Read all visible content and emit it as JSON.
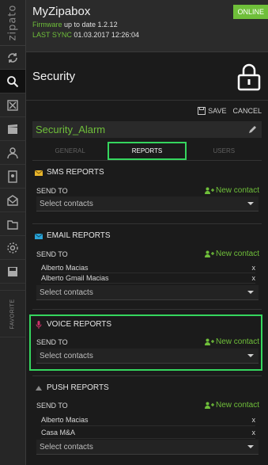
{
  "rail": {
    "logo": "zipato",
    "favorite_label": "FAVORITE"
  },
  "header": {
    "title": "MyZipabox",
    "status": "ONLINE",
    "firmware_label": "Firmware",
    "firmware_text": "up to date 1.2.12",
    "sync_label": "LAST SYNC",
    "sync_value": "01.03.2017 12:26:04"
  },
  "page": {
    "title": "Security"
  },
  "actions": {
    "save": "SAVE",
    "cancel": "CANCEL"
  },
  "rule_name": "Security_Alarm",
  "tabs": [
    {
      "label": "GENERAL"
    },
    {
      "label": "REPORTS"
    },
    {
      "label": "USERS"
    }
  ],
  "sms": {
    "title": "SMS REPORTS",
    "send_to": "SEND TO",
    "new_contact": "New contact",
    "select_placeholder": "Select contacts"
  },
  "email": {
    "title": "EMAIL REPORTS",
    "send_to": "SEND TO",
    "new_contact": "New contact",
    "contacts": [
      {
        "name": "Alberto Macias",
        "remove": "x"
      },
      {
        "name": "Alberto Gmail Macias",
        "remove": "x"
      }
    ],
    "select_placeholder": "Select contacts"
  },
  "voice": {
    "title": "VOICE REPORTS",
    "send_to": "SEND TO",
    "new_contact": "New contact",
    "select_placeholder": "Select contacts"
  },
  "push": {
    "title": "PUSH REPORTS",
    "send_to": "SEND TO",
    "new_contact": "New contact",
    "contacts": [
      {
        "name": "Alberto Macias",
        "remove": "x"
      },
      {
        "name": "Casa M&A",
        "remove": "x"
      }
    ],
    "select_placeholder": "Select contacts"
  },
  "colors": {
    "accent": "#6fbf3a",
    "highlight": "#35d65e"
  }
}
